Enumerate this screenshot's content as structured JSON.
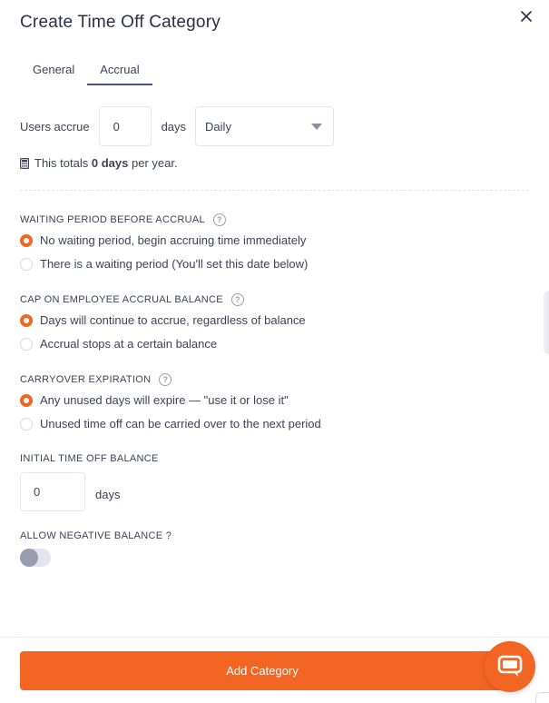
{
  "modal": {
    "title": "Create Time Off Category"
  },
  "tabs": [
    {
      "label": "General",
      "active": false
    },
    {
      "label": "Accrual",
      "active": true
    }
  ],
  "accrual": {
    "users_accrue_label": "Users accrue",
    "amount_value": "0",
    "days_label": "days",
    "frequency_selected": "Daily"
  },
  "totals": {
    "prefix": "This totals",
    "value": "0 days",
    "suffix": "per year."
  },
  "waiting_period": {
    "label": "WAITING PERIOD BEFORE ACCRUAL",
    "options": [
      {
        "label": "No waiting period, begin accruing time immediately",
        "selected": true
      },
      {
        "label": "There is a waiting period (You'll set this date below)",
        "selected": false
      }
    ]
  },
  "cap": {
    "label": "CAP ON EMPLOYEE ACCRUAL BALANCE",
    "options": [
      {
        "label": "Days will continue to accrue, regardless of balance",
        "selected": true
      },
      {
        "label": "Accrual stops at a certain balance",
        "selected": false
      }
    ]
  },
  "carryover": {
    "label": "CARRYOVER EXPIRATION",
    "options": [
      {
        "label": "Any unused days will expire — \"use it or lose it\"",
        "selected": true
      },
      {
        "label": "Unused time off can be carried over to the next period",
        "selected": false
      }
    ]
  },
  "initial_balance": {
    "label": "INITIAL TIME OFF BALANCE",
    "value": "0",
    "unit": "days"
  },
  "negative_balance": {
    "label": "ALLOW NEGATIVE BALANCE ?",
    "enabled": false
  },
  "footer": {
    "add_button_label": "Add Category"
  },
  "colors": {
    "accent": "#f26522",
    "tab_underline": "#4a5088",
    "text": "#3d4256"
  },
  "icons": {
    "close": "close-icon",
    "help": "help-icon",
    "calculator": "calculator-icon",
    "chat": "chat-icon"
  }
}
